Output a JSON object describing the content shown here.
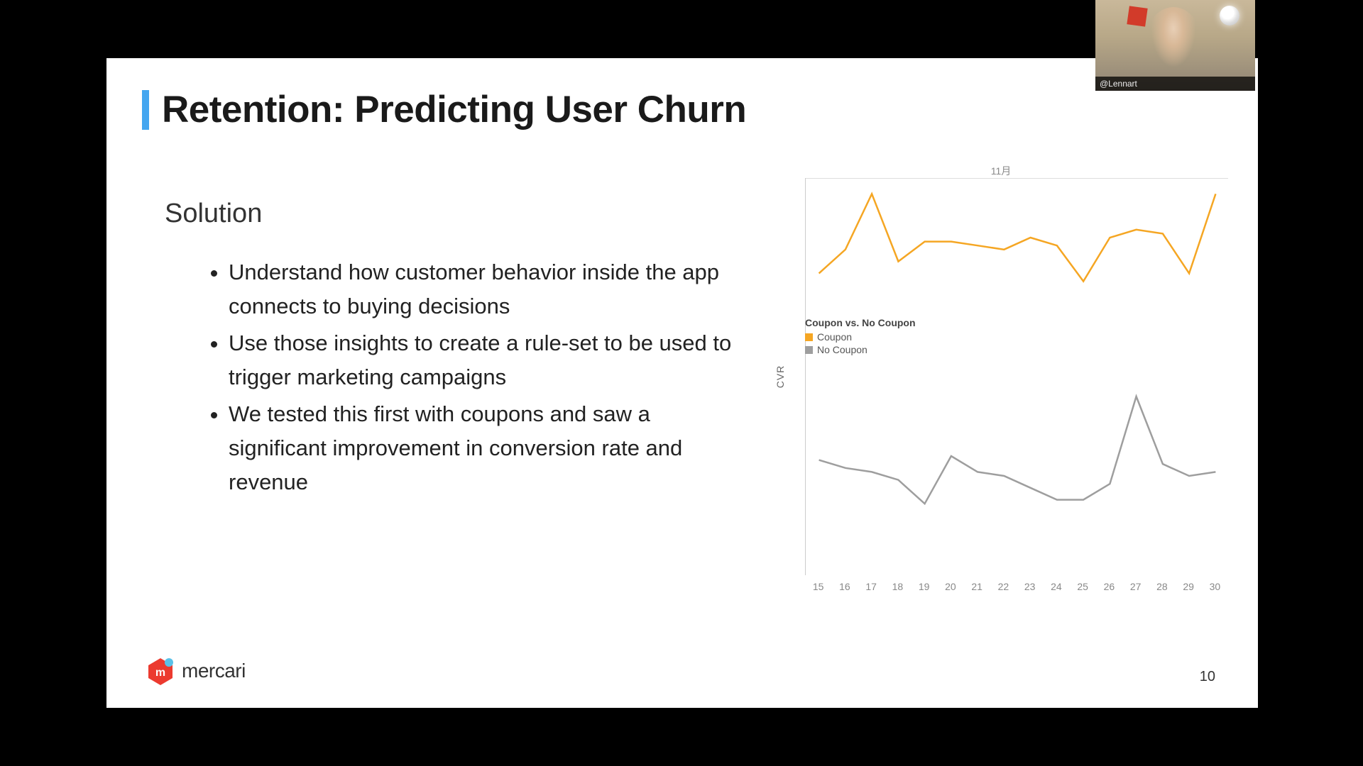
{
  "title": "Retention: Predicting User Churn",
  "subhead": "Solution",
  "bullets": [
    "Understand how customer behavior inside the app connects to buying decisions",
    "Use those insights to create a rule-set to be used to trigger marketing campaigns",
    "We tested this first with coupons and saw a significant improvement in conversion rate and revenue"
  ],
  "logo_text": "mercari",
  "page_number": "10",
  "webcam_name": "@Lennart",
  "chart": {
    "month_header": "11月",
    "y_label": "CVR",
    "legend_title": "Coupon vs. No Coupon",
    "legend": {
      "coupon": "Coupon",
      "no_coupon": "No Coupon"
    },
    "colors": {
      "coupon": "#f5a623",
      "no_coupon": "#9e9e9e"
    },
    "x_ticks": [
      "15",
      "16",
      "17",
      "18",
      "19",
      "20",
      "21",
      "22",
      "23",
      "24",
      "25",
      "26",
      "27",
      "28",
      "29",
      "30"
    ]
  },
  "chart_data": {
    "type": "line",
    "title": "Coupon vs. No Coupon",
    "xlabel": "",
    "ylabel": "CVR",
    "ylim": [
      0,
      100
    ],
    "categories": [
      "15",
      "16",
      "17",
      "18",
      "19",
      "20",
      "21",
      "22",
      "23",
      "24",
      "25",
      "26",
      "27",
      "28",
      "29",
      "30"
    ],
    "series": [
      {
        "name": "Coupon",
        "values": [
          76,
          82,
          96,
          79,
          84,
          84,
          83,
          82,
          85,
          83,
          74,
          85,
          87,
          86,
          76,
          96
        ]
      },
      {
        "name": "No Coupon",
        "values": [
          29,
          27,
          26,
          24,
          18,
          30,
          26,
          25,
          22,
          19,
          19,
          23,
          45,
          28,
          25,
          26
        ]
      }
    ]
  }
}
